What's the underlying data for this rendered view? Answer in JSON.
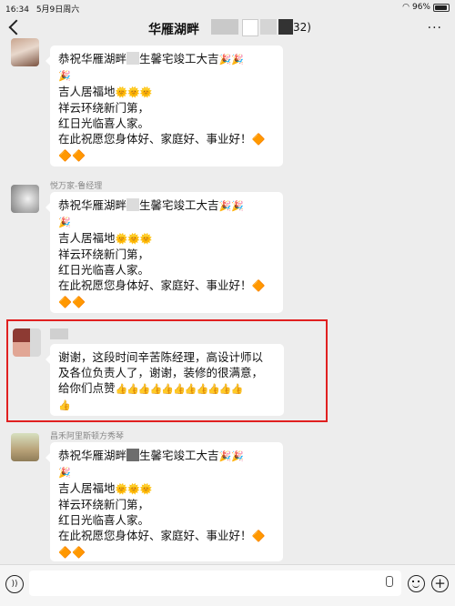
{
  "status_bar": {
    "time": "16:34",
    "date": "5月9日周六",
    "wifi_icon": "wifi-icon",
    "battery_text": "96%",
    "battery_level": 0.96
  },
  "header": {
    "title": "华雁湖畔",
    "member_count": "32)",
    "back_icon": "back-chevron-icon",
    "more_icon": "more-icon",
    "more_glyph": "···"
  },
  "messages": [
    {
      "sender": "",
      "lines": [
        "恭祝华雁湖畔",
        "生馨宅竣工大吉",
        "吉人居福地",
        "祥云环绕新门第，",
        "红日光临喜人家。",
        "在此祝愿您身体好、家庭好、事业好！"
      ]
    },
    {
      "sender": "悦万家-鲁经理",
      "lines": [
        "恭祝华雁湖畔",
        "生馨宅竣工大吉",
        "吉人居福地",
        "祥云环绕新门第，",
        "红日光临喜人家。",
        "在此祝愿您身体好、家庭好、事业好！"
      ]
    },
    {
      "sender": "",
      "lines": [
        "谢谢，这段时间辛苦陈经理，高设计师以",
        "及各位负责人了，谢谢，装修的很满意，",
        "给你们点赞"
      ]
    },
    {
      "sender": "昌禾阿里斯顿方秀琴",
      "lines": [
        "恭祝华雁湖畔",
        "生馨宅竣工大吉",
        "吉人居福地",
        "祥云环绕新门第，",
        "红日光临喜人家。",
        "在此祝愿您身体好、家庭好、事业好！"
      ]
    }
  ],
  "emoji": {
    "party": "🎉",
    "sun": "🌞",
    "diamond": "🔶",
    "thumb": "👍"
  },
  "input_bar": {
    "placeholder": "",
    "voice_icon": "voice-icon",
    "mic_icon": "microphone-icon",
    "emoji_icon": "emoji-icon",
    "plus_icon": "plus-icon",
    "voice_glyph": "))",
    "plus_glyph": "+"
  },
  "colors": {
    "chat_bg": "#ededed",
    "bubble_bg": "#ffffff",
    "highlight": "#e02020"
  }
}
